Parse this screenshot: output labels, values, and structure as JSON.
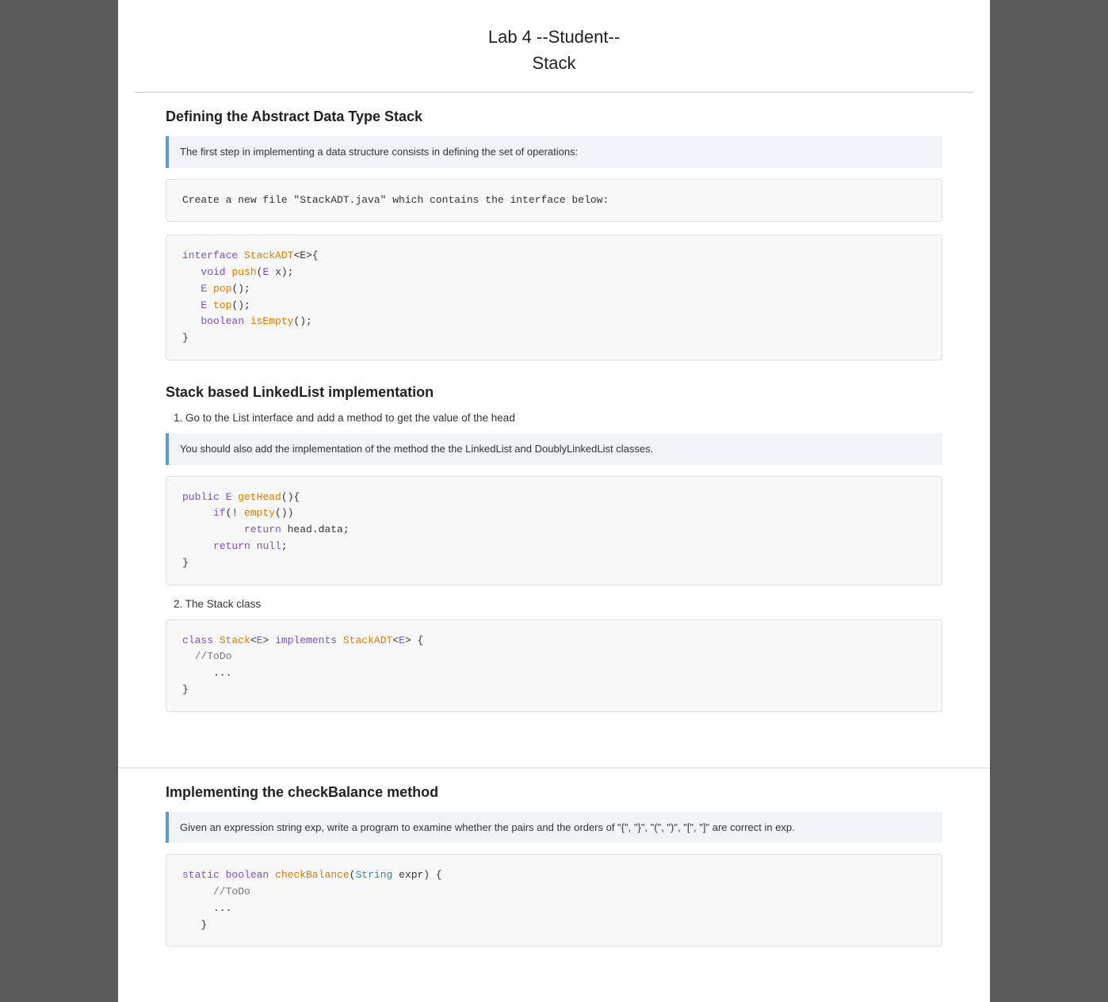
{
  "header": {
    "line1": "Lab 4 --Student--",
    "line2": "Stack"
  },
  "sections": [
    {
      "id": "section-adt",
      "title": "Defining the Abstract Data Type Stack",
      "info": "The first step in implementing a data structure consists in defining the set of operations:",
      "instruction": "Create a new file \"StackADT.java\" which contains the interface below:",
      "code": "interface StackADT<E>{\n   void push(E x);\n   E pop();\n   E top();\n   boolean isEmpty();\n}"
    },
    {
      "id": "section-linked",
      "title": "Stack based LinkedList implementation",
      "steps": [
        {
          "number": "1.",
          "text": "Go to the List interface and add a method to get the value of the head",
          "info": "You should also add the implementation of the method the the LinkedList and DoublyLinkedList classes.",
          "code": "public E getHead(){\n     if(! empty())\n          return head.data;\n     return null;\n}"
        },
        {
          "number": "2.",
          "text": "The Stack class",
          "code": "class Stack<E> implements StackADT<E> {\n  //ToDo\n     ...\n}"
        }
      ]
    },
    {
      "id": "section-checkbalance",
      "title": "Implementing the checkBalance method",
      "info": "Given an expression string exp, write a program to examine whether the pairs and the orders of \"{\", \"}\", \"(\", \")\", \"[\", \"]\" are correct in exp.",
      "code": "static boolean checkBalance(String expr) {\n     //ToDo\n     ...\n   }"
    }
  ]
}
